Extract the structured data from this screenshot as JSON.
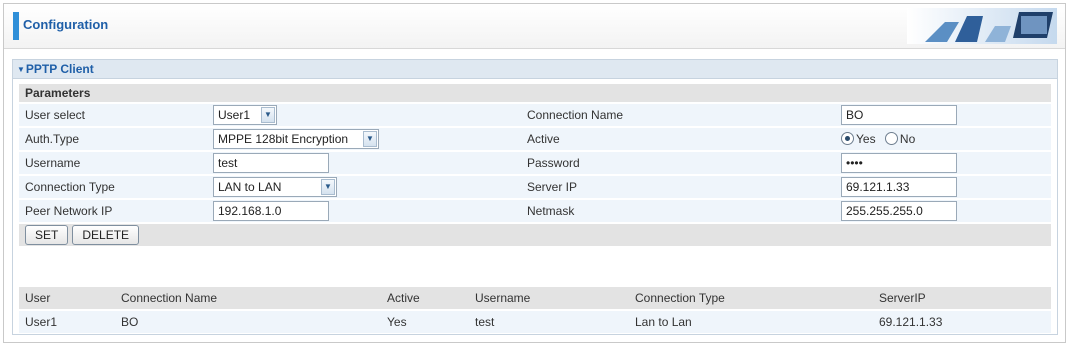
{
  "header": {
    "title": "Configuration"
  },
  "section": {
    "title": "PPTP Client"
  },
  "params": {
    "heading": "Parameters",
    "user_select_label": "User select",
    "user_select_value": "User1",
    "connection_name_label": "Connection Name",
    "connection_name_value": "BO",
    "auth_type_label": "Auth.Type",
    "auth_type_value": "MPPE 128bit Encryption",
    "active_label": "Active",
    "active_yes": "Yes",
    "active_no": "No",
    "username_label": "Username",
    "username_value": "test",
    "password_label": "Password",
    "password_value": "••••",
    "connection_type_label": "Connection Type",
    "connection_type_value": "LAN to LAN",
    "server_ip_label": "Server IP",
    "server_ip_value": "69.121.1.33",
    "peer_network_ip_label": "Peer Network IP",
    "peer_network_ip_value": "192.168.1.0",
    "netmask_label": "Netmask",
    "netmask_value": "255.255.255.0"
  },
  "buttons": {
    "set": "SET",
    "delete": "DELETE"
  },
  "table": {
    "headers": [
      "User",
      "Connection Name",
      "Active",
      "Username",
      "Connection Type",
      "ServerIP"
    ],
    "rows": [
      [
        "User1",
        "BO",
        "Yes",
        "test",
        "Lan to Lan",
        "69.121.1.33"
      ]
    ]
  }
}
